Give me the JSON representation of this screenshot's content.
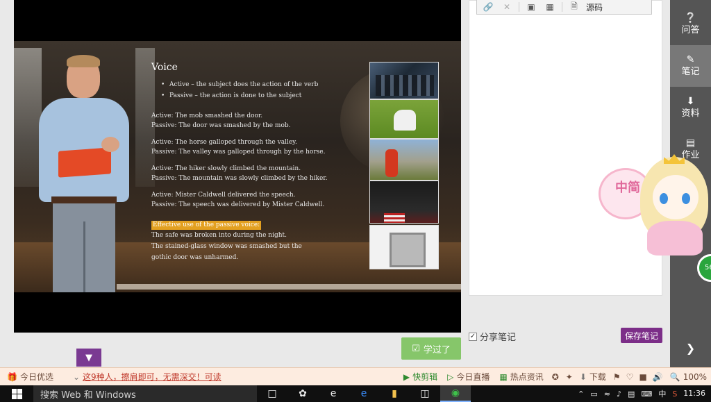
{
  "slide": {
    "title": "Voice",
    "bullets": [
      "Active  – the subject does the action of the verb",
      "Passive  – the action is done to the subject"
    ],
    "pairs": [
      {
        "active": "Active: The mob smashed the door.",
        "passive": "Passive: The door was smashed by the mob."
      },
      {
        "active": "Active: The horse galloped through the valley.",
        "passive": "Passive: The valley was galloped through by the horse."
      },
      {
        "active": "Active: The hiker slowly climbed the mountain.",
        "passive": "Passive: The mountain was slowly climbed by the hiker."
      },
      {
        "active": "Active: Mister Caldwell delivered the speech.",
        "passive": "Passive: The speech was delivered by Mister Caldwell."
      }
    ],
    "passive_heading": "Effective use of the passive voice:",
    "passive_examples": [
      "The safe was broken into during the night.",
      "The stained-glass window was smashed but the",
      "gothic door was unharmed."
    ]
  },
  "learned_button": "学过了",
  "expand_icon": "chevron-down-icon",
  "notes": {
    "toolbar": {
      "source_label": "源码"
    },
    "share_label": "分享笔记",
    "share_checked": true,
    "save_label": "保存笔记"
  },
  "right_nav": {
    "items": [
      {
        "label": "问答",
        "icon": "question-icon"
      },
      {
        "label": "笔记",
        "icon": "edit-icon"
      },
      {
        "label": "资料",
        "icon": "download-icon"
      },
      {
        "label": "作业",
        "icon": "document-icon"
      }
    ],
    "active_index": 1
  },
  "mascot": {
    "bubble_text": "中简",
    "badge": "56"
  },
  "statusbar": {
    "today_pick": "今日优选",
    "news": "这9种人，擦肩即可，无需深交！可读",
    "quick_clip": "快剪辑",
    "live": "今日直播",
    "hot_news": "热点资讯",
    "download": "下载",
    "zoom": "100%"
  },
  "taskbar": {
    "search_placeholder": "搜索 Web 和 Windows",
    "ime": "中",
    "time": "11:36"
  },
  "colors": {
    "accent_purple": "#7c2e88",
    "learned_green": "#86c66a",
    "nav_bg": "#555555"
  }
}
